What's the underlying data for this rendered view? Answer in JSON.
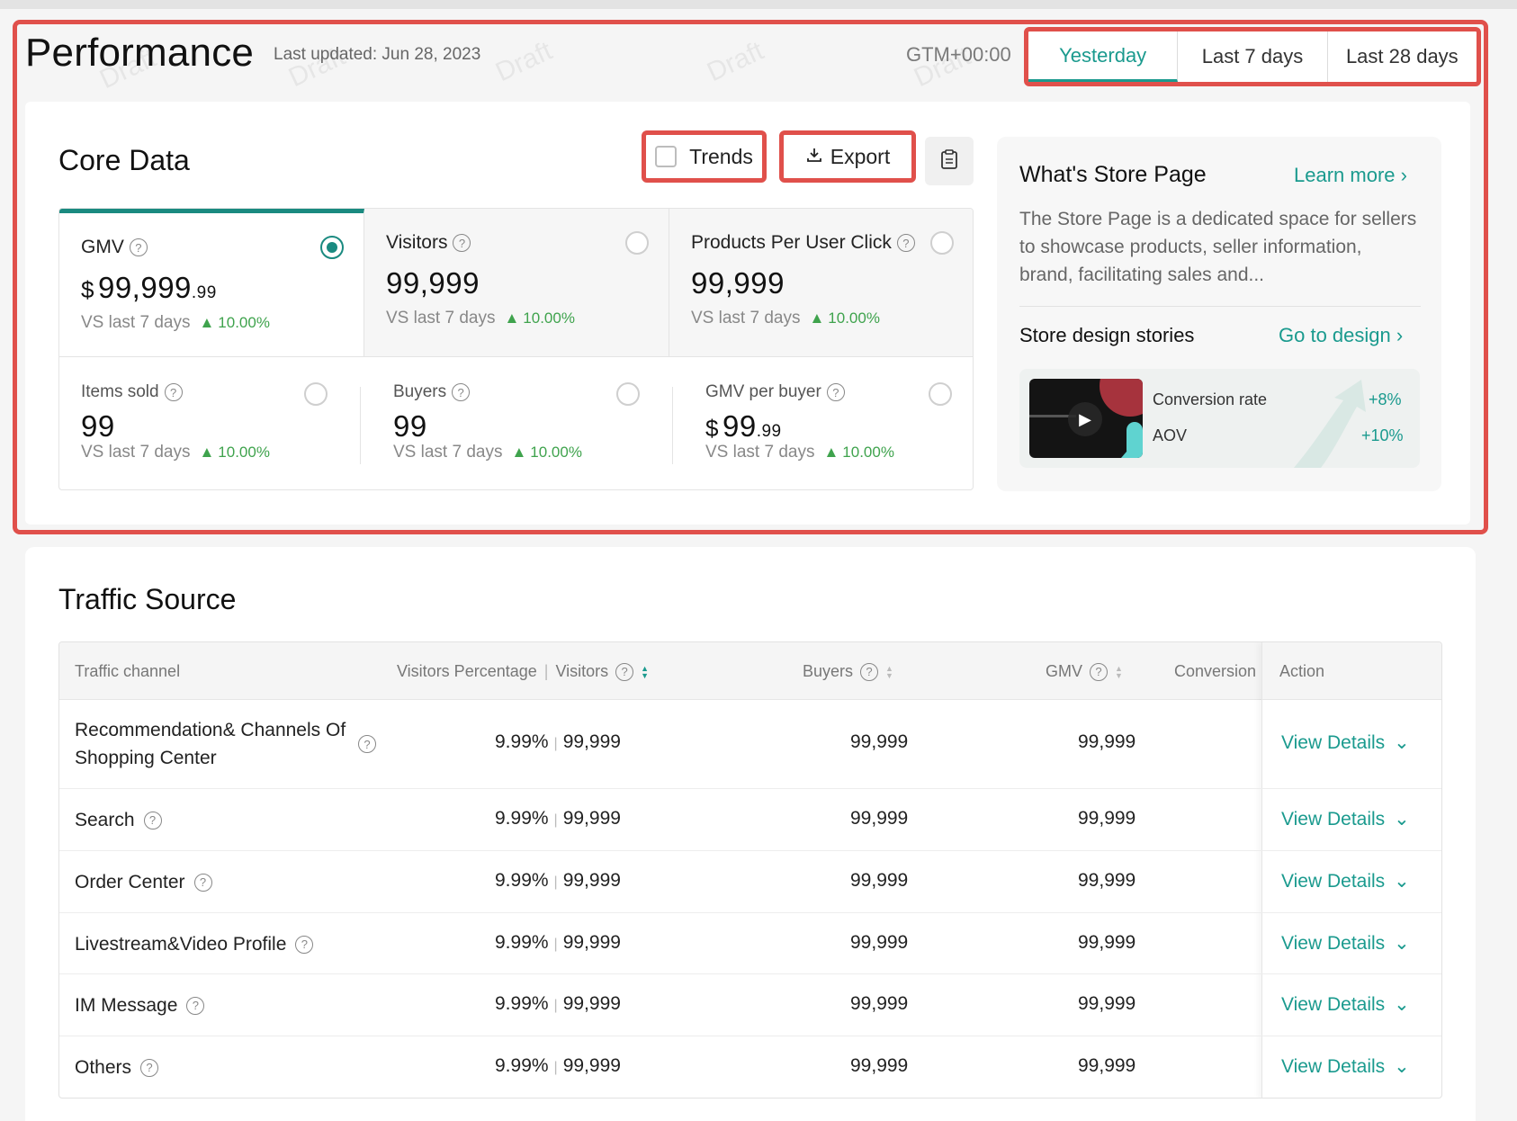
{
  "header": {
    "title": "Performance",
    "last_updated": "Last updated: Jun 28, 2023",
    "watermark": "Draft",
    "timezone": "GTM+00:00",
    "date_tabs": [
      "Yesterday",
      "Last 7 days",
      "Last 28 days"
    ],
    "active_tab": "Yesterday"
  },
  "core": {
    "title": "Core Data",
    "trends_label": "Trends",
    "export_label": "Export",
    "metrics": [
      {
        "label": "GMV",
        "currency": "$",
        "value": "99,999",
        "cents": ".99",
        "vs": "VS last 7 days",
        "change": "10.00%",
        "selected": true
      },
      {
        "label": "Visitors",
        "value": "99,999",
        "vs": "VS last 7 days",
        "change": "10.00%"
      },
      {
        "label": "Products Per User Click",
        "value": "99,999",
        "vs": "VS last 7 days",
        "change": "10.00%"
      },
      {
        "label": "Items sold",
        "value": "99",
        "vs": "VS last 7 days",
        "change": "10.00%"
      },
      {
        "label": "Buyers",
        "value": "99",
        "vs": "VS last 7 days",
        "change": "10.00%"
      },
      {
        "label": "GMV per buyer",
        "currency": "$",
        "value": "99",
        "cents": ".99",
        "vs": "VS last 7 days",
        "change": "10.00%"
      }
    ]
  },
  "store": {
    "title": "What's Store Page",
    "learn_more": "Learn more",
    "description": "The Store Page is a dedicated space for sellers to showcase products, seller information, brand, facilitating sales and...",
    "stories_title": "Store design stories",
    "go_design": "Go to design",
    "conversion_label": "Conversion rate",
    "conversion_value": "+8%",
    "aov_label": "AOV",
    "aov_value": "+10%"
  },
  "traffic": {
    "title": "Traffic Source",
    "columns": {
      "channel": "Traffic channel",
      "visitors_pct": "Visitors Percentage",
      "visitors": "Visitors",
      "buyers": "Buyers",
      "gmv": "GMV",
      "conversion": "Conversion",
      "action": "Action"
    },
    "rows": [
      {
        "channel": "Recommendation& Channels Of Shopping Center",
        "pct": "9.99%",
        "visitors": "99,999",
        "buyers": "99,999",
        "gmv": "99,999",
        "action": "View Details"
      },
      {
        "channel": "Search",
        "pct": "9.99%",
        "visitors": "99,999",
        "buyers": "99,999",
        "gmv": "99,999",
        "action": "View Details"
      },
      {
        "channel": "Order Center",
        "pct": "9.99%",
        "visitors": "99,999",
        "buyers": "99,999",
        "gmv": "99,999",
        "action": "View Details"
      },
      {
        "channel": "Livestream&Video Profile",
        "pct": "9.99%",
        "visitors": "99,999",
        "buyers": "99,999",
        "gmv": "99,999",
        "action": "View Details"
      },
      {
        "channel": "IM Message",
        "pct": "9.99%",
        "visitors": "99,999",
        "buyers": "99,999",
        "gmv": "99,999",
        "action": "View Details"
      },
      {
        "channel": "Others",
        "pct": "9.99%",
        "visitors": "99,999",
        "buyers": "99,999",
        "gmv": "99,999",
        "action": "View Details"
      }
    ]
  },
  "colors": {
    "accent": "#1a9a8e",
    "highlight": "#e0504b",
    "positive": "#3fa34d"
  }
}
